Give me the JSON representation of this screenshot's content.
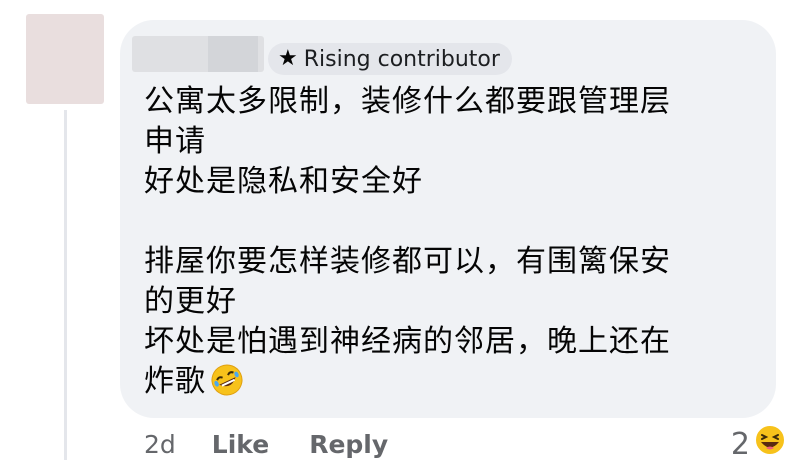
{
  "comment": {
    "badge_label": "Rising contributor",
    "badge_icon": "star-icon",
    "text": "公寓太多限制，装修什么都要跟管理层\n申请\n好处是隐私和安全好\n\n排屋你要怎样装修都可以，有围篱保安\n的更好\n坏处是怕遇到神经病的邻居，晚上还在\n炸歌",
    "inline_emoji": "rolling-on-floor-laughing-icon"
  },
  "actions": {
    "time": "2d",
    "like_label": "Like",
    "reply_label": "Reply"
  },
  "reactions": {
    "count": "2",
    "icon": "haha-reaction-icon"
  }
}
